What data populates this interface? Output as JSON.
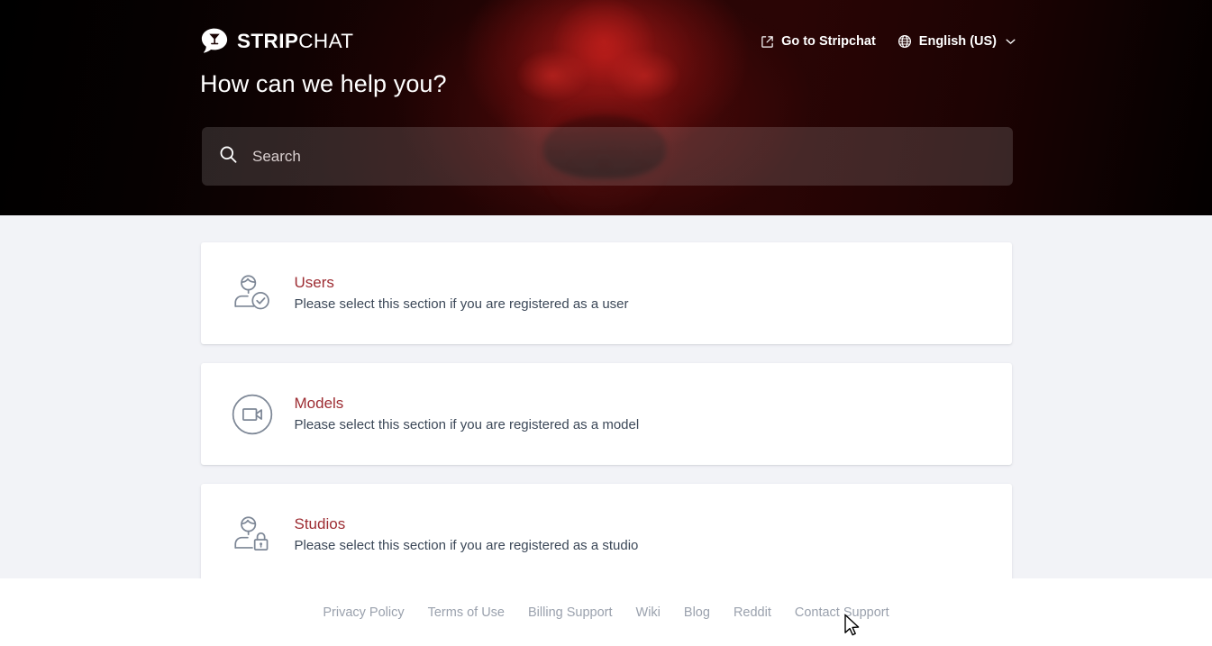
{
  "brand": {
    "logo_icon": "speech-bubble-cocktail-logo-icon",
    "name_bold": "STRIP",
    "name_light": "CHAT"
  },
  "header": {
    "go_to_site": {
      "label": "Go to Stripchat",
      "icon": "external-link-icon"
    },
    "language": {
      "label": "English (US)",
      "icon": "globe-icon",
      "chevron": "chevron-down-icon"
    },
    "title": "How can we help you?"
  },
  "search": {
    "icon": "search-icon",
    "placeholder": "Search",
    "value": ""
  },
  "sections": [
    {
      "icon": "user-check-icon",
      "title": "Users",
      "description": "Please select this section if you are registered as a user"
    },
    {
      "icon": "video-camera-circle-icon",
      "title": "Models",
      "description": "Please select this section if you are registered as a model"
    },
    {
      "icon": "user-lock-icon",
      "title": "Studios",
      "description": "Please select this section if you are registered as a studio"
    }
  ],
  "footer": {
    "links": [
      {
        "label": "Privacy Policy"
      },
      {
        "label": "Terms of Use"
      },
      {
        "label": "Billing Support"
      },
      {
        "label": "Wiki"
      },
      {
        "label": "Blog"
      },
      {
        "label": "Reddit"
      },
      {
        "label": "Contact Support"
      }
    ]
  },
  "colors": {
    "accent_title": "#9d2c32",
    "page_bg": "#f2f3f7",
    "hero_bg": "#2a0505",
    "footer_link": "#9aa1ad",
    "body_text": "#3c4858"
  },
  "cursor": {
    "icon": "mouse-arrow-cursor-icon"
  }
}
